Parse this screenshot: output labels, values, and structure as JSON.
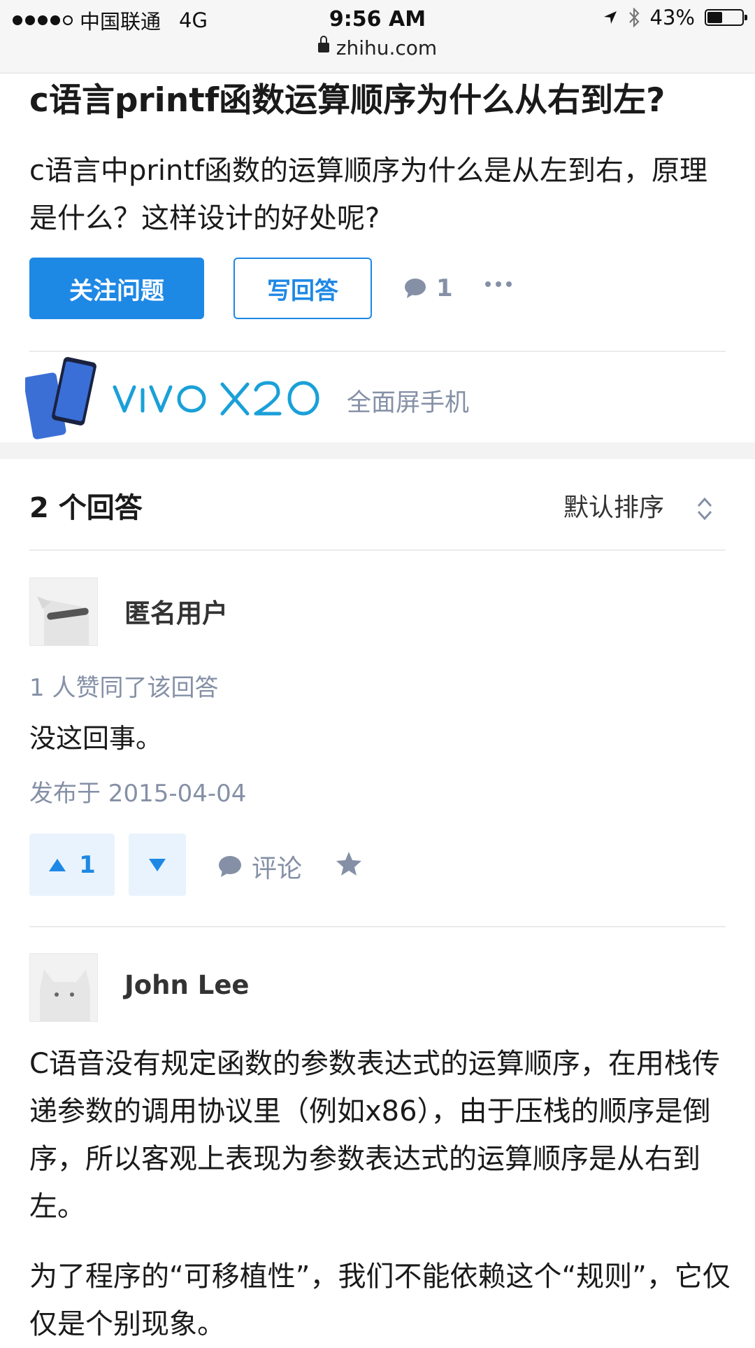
{
  "status_bar": {
    "carrier": "中国联通",
    "network": "4G",
    "time": "9:56 AM",
    "battery": "43%",
    "battery_level": 0.43,
    "url": "zhihu.com"
  },
  "question": {
    "title": "c语言printf函数运算顺序为什么从右到左?",
    "description": "c语言中printf函数的运算顺序为什么是从左到右，原理是什么？这样设计的好处呢?",
    "follow_label": "关注问题",
    "answer_label": "写回答",
    "comment_count": "1"
  },
  "ad": {
    "brand": "vivo X20",
    "tagline": "全面屏手机"
  },
  "answers_header": {
    "count_label": "2 个回答",
    "sort_label": "默认排序"
  },
  "answers": [
    {
      "author": "匿名用户",
      "votes_text": "1 人赞同了该回答",
      "content": "没这回事。",
      "published": "发布于 2015-04-04",
      "upvotes": "1",
      "comment_label": "评论"
    },
    {
      "author": "John Lee",
      "paragraphs": [
        "C语音没有规定函数的参数表达式的运算顺序，在用栈传递参数的调用协议里（例如x86），由于压栈的顺序是倒序，所以客观上表现为参数表达式的运算顺序是从右到左。",
        "为了程序的“可移植性”，我们不能依赖这个“规则”，它仅仅是个别现象。"
      ]
    }
  ],
  "colors": {
    "primary": "#1e88e5",
    "meta_grey": "#8590a6",
    "vote_bg": "#e9f3fd"
  }
}
